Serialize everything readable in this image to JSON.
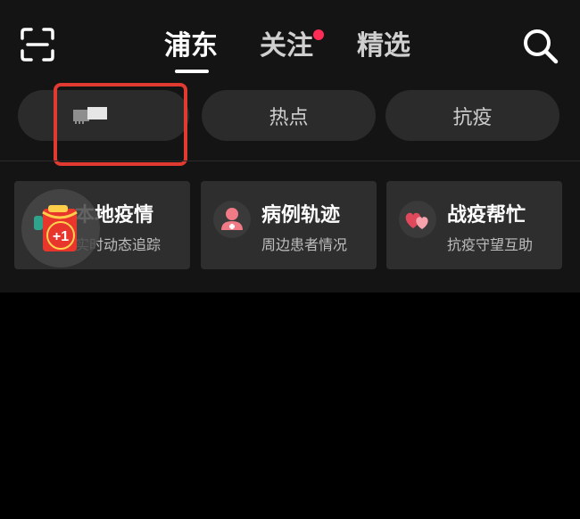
{
  "header": {
    "tabs": [
      {
        "label": "浦东",
        "active": true
      },
      {
        "label": "关注",
        "active": false,
        "has_dot": true
      },
      {
        "label": "精选",
        "active": false
      }
    ],
    "scan_icon": "scan-icon",
    "search_icon": "search-icon"
  },
  "channels": {
    "items": [
      {
        "label": ""
      },
      {
        "label": "热点"
      },
      {
        "label": "抗疫"
      }
    ]
  },
  "cards": [
    {
      "title": "本地疫情",
      "subtitle": "实时动态追踪",
      "icon": "shield-icon"
    },
    {
      "title": "病例轨迹",
      "subtitle": "周边患者情况",
      "icon": "person-icon"
    },
    {
      "title": "战疫帮忙",
      "subtitle": "抗疫守望互助",
      "icon": "hearts-icon"
    }
  ],
  "float_bubble": {
    "badge": "+1",
    "icon": "red-packet-icon"
  },
  "colors": {
    "background": "#000000",
    "panel": "#141414",
    "pill": "#2b2b2b",
    "card": "#2e2e2e",
    "accent_red": "#ff2d55",
    "highlight": "#e03a31"
  }
}
